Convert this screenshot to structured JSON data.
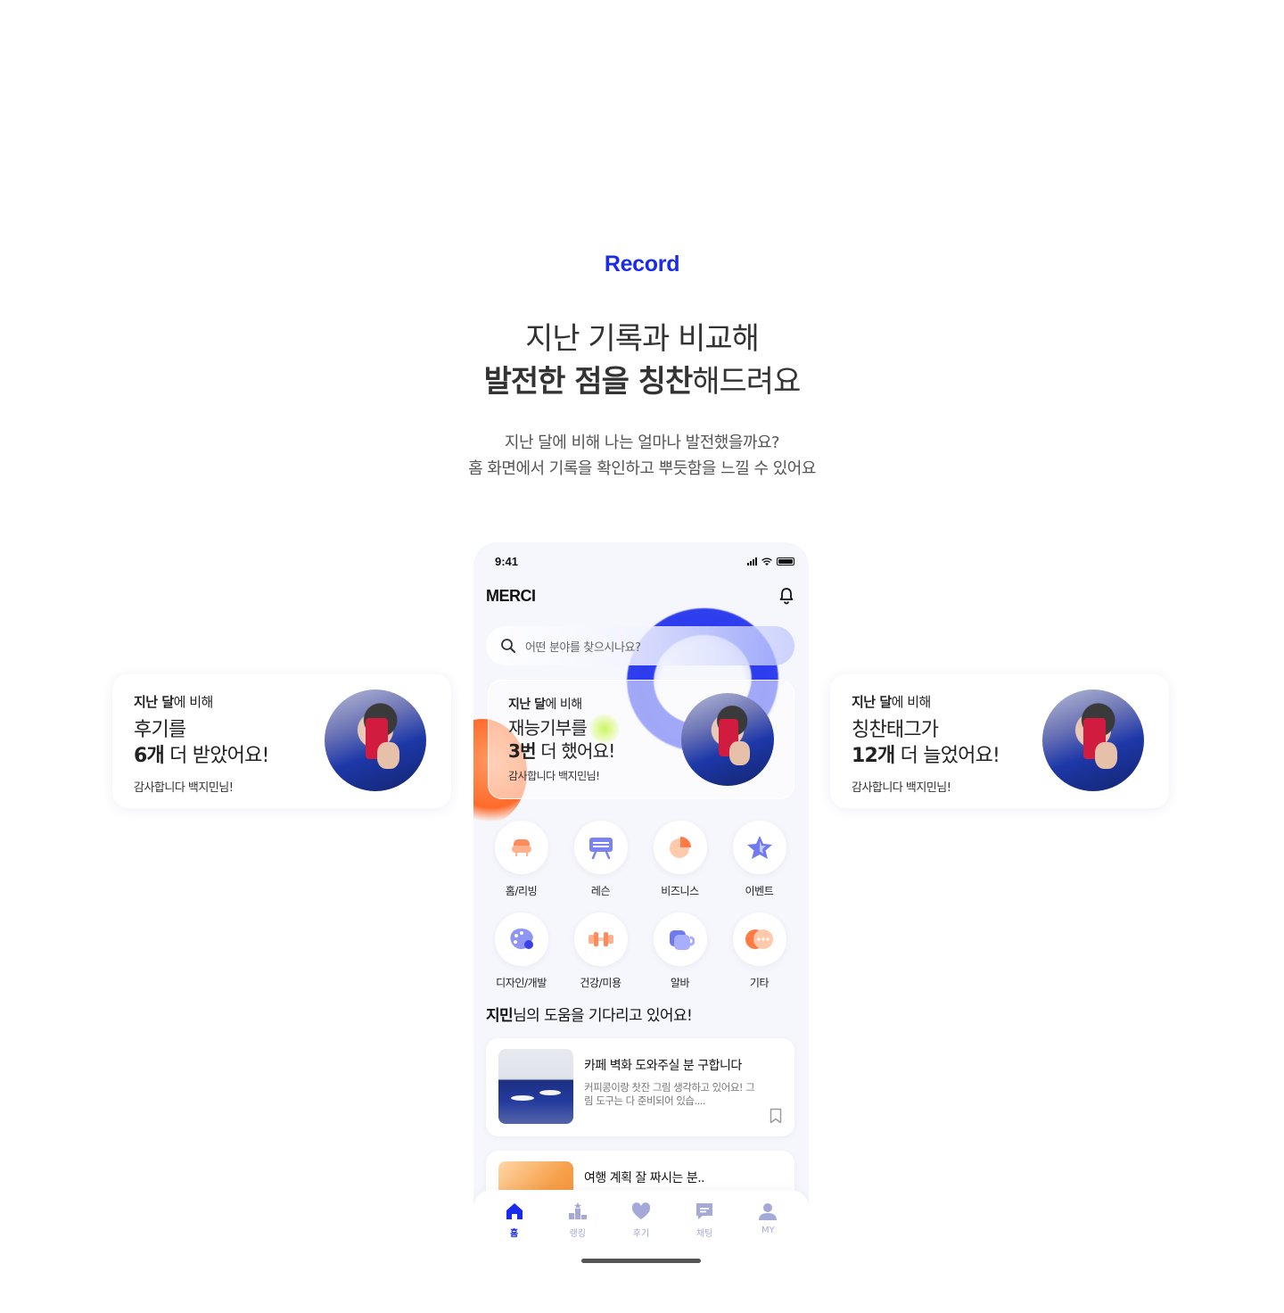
{
  "section": {
    "tag": "Record",
    "headline_line1": "지난 기록과 비교해",
    "headline_line2_bold": "발전한 점을 칭찬",
    "headline_line2_rest": "해드려요",
    "desc_line1": "지난 달에 비해 나는 얼마나 발전했을까요?",
    "desc_line2": "홈 화면에서 기록을 확인하고 뿌듯함을 느낄 수 있어요"
  },
  "cards": {
    "left": {
      "kicker_bold": "지난 달",
      "kicker_rest": "에 비해",
      "line1": "후기를",
      "line2_bold": "6개",
      "line2_rest": " 더 받았어요!",
      "thanks": "감사합니다 백지민님!"
    },
    "center": {
      "kicker_bold": "지난 달",
      "kicker_rest": "에 비해",
      "line1": "재능기부를",
      "line2_bold": "3번",
      "line2_rest": " 더 했어요!",
      "thanks": "감사합니다 백지민님!"
    },
    "right": {
      "kicker_bold": "지난 달",
      "kicker_rest": "에 비해",
      "line1": "칭찬태그가",
      "line2_bold": "12개",
      "line2_rest": " 더 늘었어요!",
      "thanks": "감사합니다 백지민님!"
    }
  },
  "phone": {
    "status_time": "9:41",
    "app_name": "MERCI",
    "search_placeholder": "어떤 분야를 찾으시나요?",
    "categories": [
      {
        "label": "홈/리빙",
        "icon": "sofa-icon",
        "color": "#ff8a5c"
      },
      {
        "label": "레슨",
        "icon": "board-icon",
        "color": "#7b83f0"
      },
      {
        "label": "비즈니스",
        "icon": "pie-chart-icon",
        "color": "#ff7a45"
      },
      {
        "label": "이벤트",
        "icon": "star-icon",
        "color": "#6f79f2"
      },
      {
        "label": "디자인/개발",
        "icon": "palette-icon",
        "color": "#8e95f5"
      },
      {
        "label": "건강/미용",
        "icon": "dumbbell-icon",
        "color": "#ff8a5c"
      },
      {
        "label": "알바",
        "icon": "cup-icon",
        "color": "#6f79f2"
      },
      {
        "label": "기타",
        "icon": "more-icon",
        "color": "#ff7a45"
      }
    ],
    "help_title_bold": "지민",
    "help_title_rest": "님의 도움을 기다리고 있어요!",
    "posts": [
      {
        "title": "카페 벽화 도와주실 분 구합니다",
        "body": "커피콩이랑 찻잔 그림 생각하고 있어요! 그림 도구는 다 준비되어 있습...."
      },
      {
        "title": "여행 계획 잘 짜시는 분..",
        "body": ""
      }
    ],
    "tabs": [
      {
        "label": "홈",
        "icon": "home-icon"
      },
      {
        "label": "랭킹",
        "icon": "ranking-icon"
      },
      {
        "label": "후기",
        "icon": "heart-icon"
      },
      {
        "label": "채팅",
        "icon": "chat-icon"
      },
      {
        "label": "MY",
        "icon": "profile-icon"
      }
    ],
    "colors": {
      "accent": "#1a2bf0",
      "inactive": "#a5a9d8",
      "orange": "#ff6a2b"
    }
  }
}
